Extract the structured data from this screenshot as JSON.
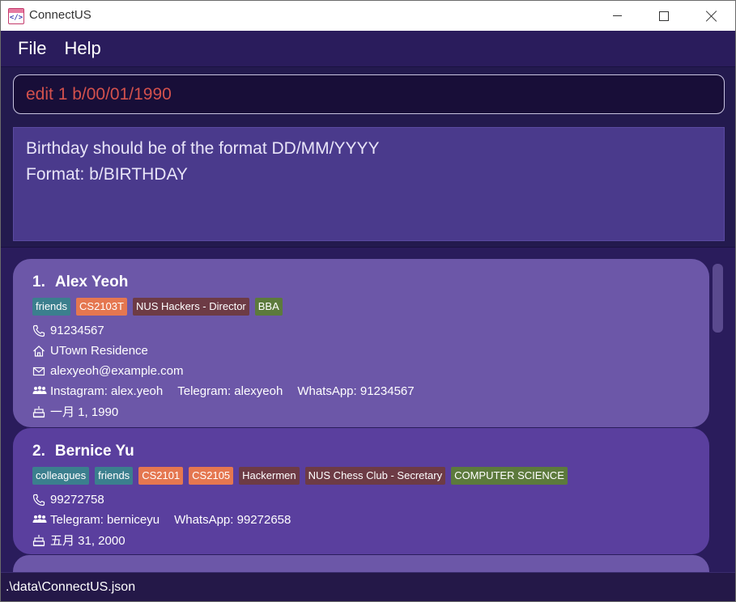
{
  "window": {
    "title": "ConnectUS",
    "icon_glyph": "</>"
  },
  "menu": {
    "items": [
      "File",
      "Help"
    ]
  },
  "command": {
    "value": "edit 1 b/00/01/1990",
    "text_color": "#d3514d"
  },
  "result": {
    "lines": [
      "Birthday should be of the format DD/MM/YYYY",
      "Format: b/BIRTHDAY"
    ]
  },
  "persons": [
    {
      "index": "1.",
      "name": "Alex Yeoh",
      "tags": [
        {
          "label": "friends",
          "color": "#3b7f8e"
        },
        {
          "label": "CS2103T",
          "color": "#e57750"
        },
        {
          "label": "NUS Hackers - Director",
          "color": "#6d3b45"
        },
        {
          "label": "BBA",
          "color": "#5c7a3c"
        }
      ],
      "phone": "91234567",
      "address": "UTown Residence",
      "email": "alexyeoh@example.com",
      "socials": [
        "Instagram: alex.yeoh",
        "Telegram: alexyeoh",
        "WhatsApp: 91234567"
      ],
      "birthday": "一月 1, 1990"
    },
    {
      "index": "2.",
      "name": "Bernice Yu",
      "tags": [
        {
          "label": "colleagues",
          "color": "#3b7f8e"
        },
        {
          "label": "friends",
          "color": "#3b7f8e"
        },
        {
          "label": "CS2101",
          "color": "#e57750"
        },
        {
          "label": "CS2105",
          "color": "#e57750"
        },
        {
          "label": "Hackermen",
          "color": "#6d3b45"
        },
        {
          "label": "NUS Chess Club - Secretary",
          "color": "#6d3b45"
        },
        {
          "label": "COMPUTER SCIENCE",
          "color": "#5c7a3c"
        }
      ],
      "phone": "99272758",
      "socials": [
        "Telegram: berniceyu",
        "WhatsApp: 99272658"
      ],
      "birthday": "五月 31, 2000"
    }
  ],
  "status": {
    "path": ".\\data\\ConnectUS.json"
  },
  "icons": {
    "phone": "phone-icon",
    "address": "home-icon",
    "email": "mail-icon",
    "socials": "people-icon",
    "birthday": "cake-icon"
  },
  "colors": {
    "background": "#231a4e",
    "menu_bg": "#2a1c5c",
    "card_odd": "#6c57a8",
    "card_even": "#5a3f9e",
    "result_bg": "#4a3a8c"
  }
}
